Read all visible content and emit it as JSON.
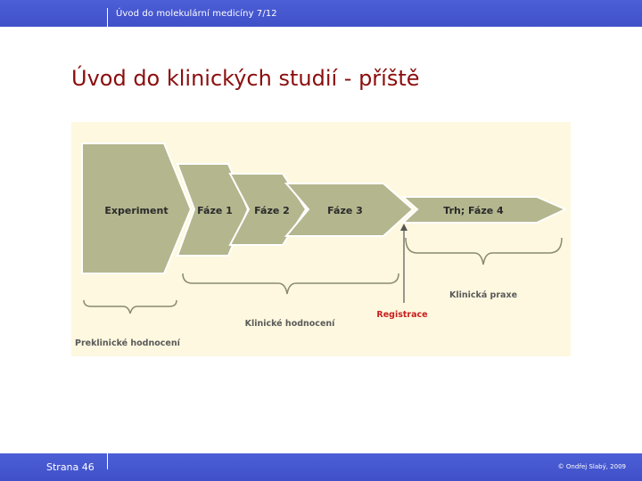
{
  "header": {
    "course_title": "Úvod do molekulární medicíny 7/12"
  },
  "slide": {
    "title": "Úvod do klinických studií - příště"
  },
  "diagram": {
    "stages": [
      "Experiment",
      "Fáze 1",
      "Fáze 2",
      "Fáze 3",
      "Trh; Fáze 4"
    ],
    "labels": {
      "preclinical": "Preklinické hodnocení",
      "clinical": "Klinické hodnocení",
      "registration": "Registrace",
      "practice": "Klinická praxe"
    },
    "colors": {
      "background": "#fdf8df",
      "arrow_fill": "#b4b68e",
      "arrow_stroke": "#ffffff",
      "bracket": "#8a8a6e",
      "text": "#2a2a2a",
      "registration": "#c81e1e"
    }
  },
  "footer": {
    "page_label": "Strana 46",
    "copyright": "© Ondřej Slabý, 2009"
  }
}
